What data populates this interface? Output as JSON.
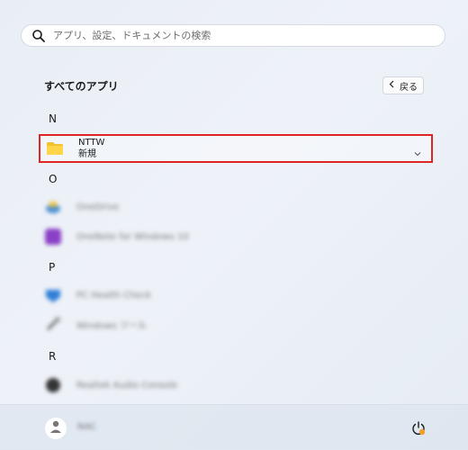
{
  "search": {
    "placeholder": "アプリ、設定、ドキュメントの検索",
    "icon": "search-icon"
  },
  "header": {
    "title": "すべてのアプリ",
    "back_label": "戻る"
  },
  "sections": [
    {
      "letter": "N"
    },
    {
      "letter": "O"
    },
    {
      "letter": "P"
    },
    {
      "letter": "R"
    }
  ],
  "apps": {
    "nttw": {
      "name": "NTTW",
      "subtitle": "新規",
      "icon": "folder-icon"
    },
    "onedrive": {
      "name": "OneDrive",
      "icon": "onedrive-icon"
    },
    "onenote": {
      "name": "OneNote for Windows 10",
      "icon": "onenote-icon"
    },
    "pchealth": {
      "name": "PC Health Check",
      "icon": "pc-health-check-icon"
    },
    "tools": {
      "name": "Windows ツール",
      "icon": "tools-icon"
    },
    "realtek": {
      "name": "Realtek Audio Console",
      "icon": "realtek-icon"
    }
  },
  "footer": {
    "user_name": "NAC",
    "power_icon": "power-icon",
    "badge_color": "#f0a030"
  },
  "colors": {
    "highlight_border": "#e02424",
    "accent": "#0067c0"
  }
}
